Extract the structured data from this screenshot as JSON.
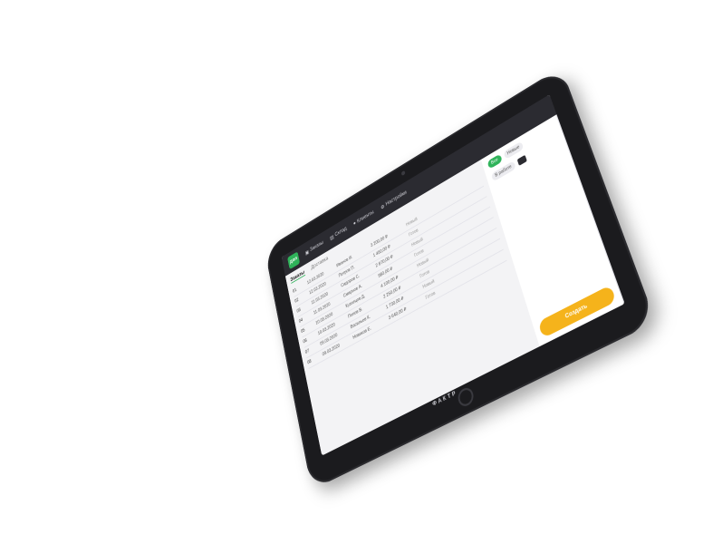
{
  "app": {
    "brand": "ФАКТР",
    "logo_text": "дол"
  },
  "nav": [
    {
      "label": "Заказы",
      "icon": "box-icon"
    },
    {
      "label": "Склад",
      "icon": "warehouse-icon"
    },
    {
      "label": "Клиенты",
      "icon": "users-icon"
    },
    {
      "label": "Настройки",
      "icon": "gear-icon"
    }
  ],
  "tabs": [
    {
      "label": "Заказы",
      "active": true
    },
    {
      "label": "Доставка",
      "active": false
    }
  ],
  "filters": {
    "pills": [
      "Все",
      "Новые",
      "В работе"
    ],
    "active_index": 0
  },
  "cta_label": "Создать",
  "rows": [
    {
      "id": "01",
      "date": "12.03.2020",
      "client": "Иванов И.",
      "amount": "3 200,00 ₽",
      "status": "Новый"
    },
    {
      "id": "02",
      "date": "12.03.2020",
      "client": "Петров П.",
      "amount": "1 450,00 ₽",
      "status": "Готов"
    },
    {
      "id": "03",
      "date": "11.03.2020",
      "client": "Сидоров С.",
      "amount": "2 870,00 ₽",
      "status": "Новый"
    },
    {
      "id": "04",
      "date": "11.03.2020",
      "client": "Смирнов А.",
      "amount": "980,00 ₽",
      "status": "Готов"
    },
    {
      "id": "05",
      "date": "10.03.2020",
      "client": "Кузнецов Д.",
      "amount": "4 100,00 ₽",
      "status": "Новый"
    },
    {
      "id": "06",
      "date": "10.03.2020",
      "client": "Попов В.",
      "amount": "2 250,00 ₽",
      "status": "Готов"
    },
    {
      "id": "07",
      "date": "09.03.2020",
      "client": "Васильев К.",
      "amount": "1 730,00 ₽",
      "status": "Новый"
    },
    {
      "id": "08",
      "date": "09.03.2020",
      "client": "Новиков Е.",
      "amount": "3 640,00 ₽",
      "status": "Готов"
    }
  ],
  "colors": {
    "accent": "#2fb35a",
    "cta": "#f5b31b",
    "topbar": "#2b2b31",
    "bezel": "#1b1b1e"
  }
}
